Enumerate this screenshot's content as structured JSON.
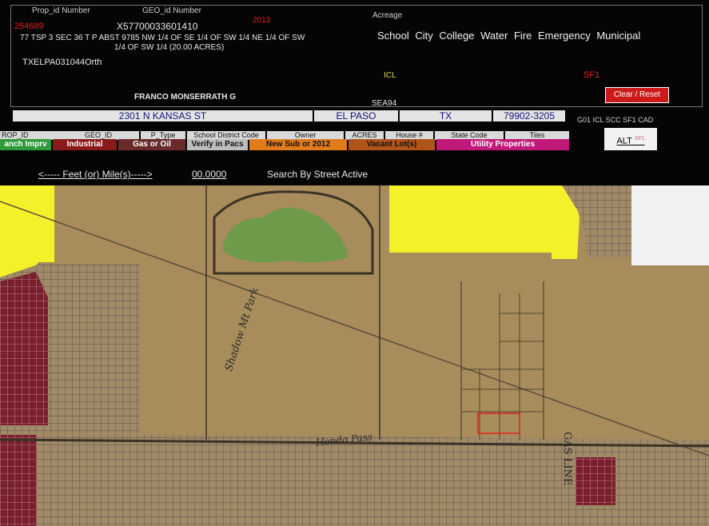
{
  "header": {
    "prop_id_label": "Prop_id Number",
    "geo_id_label": "GEO_id Number",
    "prop_id": "254689",
    "geo_id": "X57700033601410",
    "year": "2013",
    "acreage_label": "Acreage",
    "legal_line1": "77 TSP 3 SEC 36 T  P ABST 9785   NW 1/4 OF SE 1/4 OF SW 1/4  NE 1/4 OF SW",
    "legal_line2": "1/4 OF SW 1/4           (20.00 ACRES)",
    "doc_code": "TXELPA031044Orth",
    "icl": "ICL",
    "sf1": "SF1",
    "owner_name": "FRANCO MONSERRATH G",
    "sea": "SEA94",
    "categories": [
      "School",
      "City",
      "College",
      "Water",
      "Fire",
      "Emergency",
      "Municipal"
    ],
    "clear_reset": "Clear / Reset",
    "jurisdiction_codes": "G01 ICL SCC SF1 CAD",
    "alt_button": "ALT",
    "alt_code": "SF1"
  },
  "address": {
    "street": "2301 N KANSAS ST",
    "city": "EL PASO",
    "state": "TX",
    "zip": "79902-3205"
  },
  "columns": [
    "ROP_ID",
    "GEO_ID",
    "P_Type",
    "School District Code",
    "Owner",
    "ACRES",
    "House #",
    "State Code",
    "Tiles"
  ],
  "legend": [
    {
      "label": "anch Imprv",
      "bg": "#2f9a3a",
      "fg": "#ffffff"
    },
    {
      "label": "Industrial",
      "bg": "#8a1a1a",
      "fg": "#ffffff"
    },
    {
      "label": "Gas or Oil",
      "bg": "#6a2a2a",
      "fg": "#ffffff"
    },
    {
      "label": "Verify in Pacs",
      "bg": "#bdbdbd",
      "fg": "#111111"
    },
    {
      "label": "New Sub or 2012",
      "bg": "#e07a1a",
      "fg": "#111111"
    },
    {
      "label": "Vacant Lot(s)",
      "bg": "#b0541a",
      "fg": "#111111"
    },
    {
      "label": "Utility Properties",
      "bg": "#c2187a",
      "fg": "#ffffff"
    }
  ],
  "distance": {
    "label": "<----- Feet (or) Mile(s)----->",
    "value": "00.0000",
    "search_status": "Search By Street Active"
  },
  "map": {
    "handwriting_park": "Shadow Mt Park",
    "handwriting_road": "Hondo Pass",
    "handwriting_gas": "GAS LINE",
    "colors": {
      "yellow": "#f4f12a",
      "desert": "#a88c5c",
      "pond": "#6e9a4a",
      "parcel_red": "#e02020",
      "subdivision": "#7a1f2e"
    }
  }
}
